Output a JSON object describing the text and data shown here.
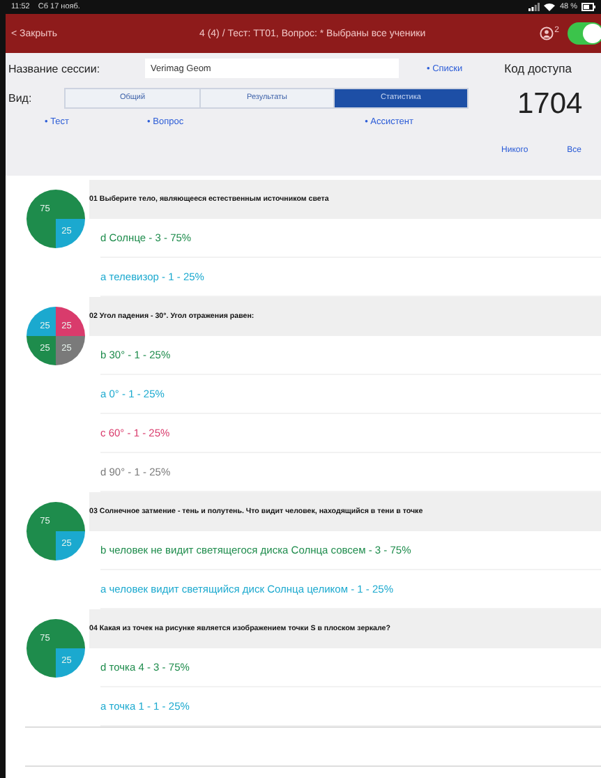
{
  "status_bar": {
    "time": "11:52",
    "date": "Сб 17 нояб.",
    "battery": "48 %"
  },
  "nav": {
    "back": "< Закрыть",
    "title": "4 (4) / Тест: ТТ01, Вопрос: * Выбраны все ученики",
    "badge": "2",
    "toggle_on": true
  },
  "session": {
    "label": "Название сессии:",
    "value": "Verimag Geom",
    "lists_link": "• Списки",
    "code_label": "Код доступа",
    "code": "1704"
  },
  "view": {
    "label": "Вид:",
    "tabs": [
      {
        "label": "Общий",
        "selected": false
      },
      {
        "label": "Результаты",
        "selected": false
      },
      {
        "label": "Статистика",
        "selected": true
      }
    ]
  },
  "links": [
    "• Тест",
    "• Вопрос",
    "• Ассистент"
  ],
  "select_links": [
    "Никого",
    "Все"
  ],
  "questions": [
    {
      "text": "01 Выберите тело, являющееся естественным источником света",
      "chart_data": {
        "type": "pie",
        "values": [
          75,
          25
        ],
        "data_labels": true
      },
      "answers": [
        {
          "text": "d Солнце - 3 - 75%",
          "color": "#1e8c4c"
        },
        {
          "text": "a телевизор - 1 - 25%",
          "color": "#1ba9cf"
        }
      ]
    },
    {
      "text": "02 Угол падения - 30°. Угол отражения равен:",
      "chart_data": {
        "type": "pie",
        "values": [
          25,
          25,
          25,
          25
        ],
        "data_labels": true
      },
      "answers": [
        {
          "text": "b 30° - 1 - 25%",
          "color": "#1e8c4c"
        },
        {
          "text": "a 0° - 1 - 25%",
          "color": "#1ba9cf"
        },
        {
          "text": "c 60° - 1 - 25%",
          "color": "#d93b6c"
        },
        {
          "text": "d 90° - 1 - 25%",
          "color": "#7a7a7a"
        }
      ]
    },
    {
      "text": "03 Солнечное затмение - тень и полутень. Что видит человек, находящийся в тени в точке",
      "chart_data": {
        "type": "pie",
        "values": [
          75,
          25
        ],
        "data_labels": true
      },
      "answers": [
        {
          "text": "b человек не видит светящегося диска Солнца совсем - 3 - 75%",
          "color": "#1e8c4c"
        },
        {
          "text": "a человек видит светящийся диск Солнца целиком - 1 - 25%",
          "color": "#1ba9cf"
        }
      ]
    },
    {
      "text": "04 Какая из точек на рисунке является изображением точки S в плоском зеркале?",
      "chart_data": {
        "type": "pie",
        "values": [
          75,
          25
        ],
        "data_labels": true
      },
      "answers": [
        {
          "text": "d точка 4 - 3 - 75%",
          "color": "#1e8c4c"
        },
        {
          "text": "a точка 1 - 1 - 25%",
          "color": "#1ba9cf"
        }
      ]
    }
  ]
}
